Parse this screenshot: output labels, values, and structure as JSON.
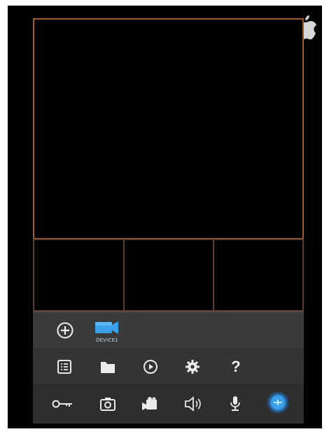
{
  "screen": {
    "background": "#000000",
    "frame_color": "#a05a2c"
  },
  "device": {
    "label": "DEVICE1",
    "icon": "camera-device-icon",
    "color": "#3aa0e8"
  },
  "toolbar": {
    "row1": [
      "plus-circle-icon",
      "camera-device-icon"
    ],
    "row2": [
      "list-icon",
      "folder-icon",
      "playback-icon",
      "gear-icon",
      "help-icon"
    ],
    "row3": [
      "key-icon",
      "snapshot-icon",
      "record-icon",
      "speaker-icon",
      "microphone-icon",
      "ptz-icon"
    ],
    "help_glyph": "?"
  }
}
